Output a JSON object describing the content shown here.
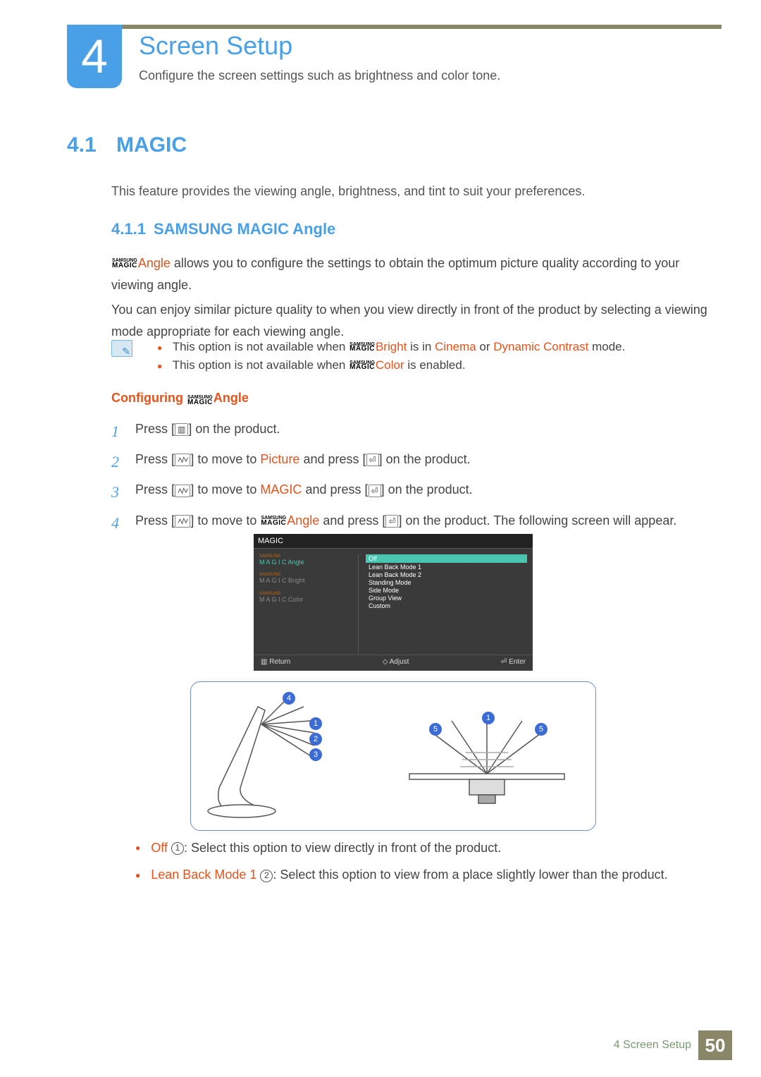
{
  "chapter": {
    "number": "4",
    "title": "Screen Setup",
    "desc": "Configure the screen settings such as brightness and color tone."
  },
  "section": {
    "number": "4.1",
    "title": "MAGIC",
    "intro": "This feature provides the viewing angle, brightness, and tint to suit your preferences."
  },
  "subsection": {
    "number": "4.1.1",
    "title": "SAMSUNG MAGIC Angle"
  },
  "para1_parts": {
    "angle": "Angle",
    "rest": " allows you to configure the settings to obtain the optimum picture quality according to your viewing angle."
  },
  "para2": "You can enjoy similar picture quality to when you view directly in front of the product by selecting a viewing mode appropriate for each viewing angle.",
  "notes": {
    "n1a": "This option is not available when ",
    "n1b": "Bright",
    "n1c": " is in ",
    "n1d": "Cinema",
    "n1e": " or ",
    "n1f": "Dynamic Contrast",
    "n1g": " mode.",
    "n2a": "This option is not available when ",
    "n2b": "Color",
    "n2c": " is enabled."
  },
  "config_heading": {
    "pre": "Configuring ",
    "post": "Angle"
  },
  "steps": {
    "s1": {
      "n": "1",
      "a": "Press [",
      "b": "] on the product."
    },
    "s2": {
      "n": "2",
      "a": "Press [",
      "b": "] to move to ",
      "c": "Picture",
      "d": " and press [",
      "e": "] on the product."
    },
    "s3": {
      "n": "3",
      "a": "Press [",
      "b": "] to move to ",
      "c": "MAGIC",
      "d": " and press [",
      "e": "] on the product."
    },
    "s4": {
      "n": "4",
      "a": "Press [",
      "b": "] to move to ",
      "c": "Angle",
      "d": " and press [",
      "e": "] on the product. The following screen will appear."
    }
  },
  "osd": {
    "title": "MAGIC",
    "left": {
      "angle": "Angle",
      "bright": "Bright",
      "color": "Color",
      "brand_top": "SAMSUNG",
      "brand_bot": "M A G I C"
    },
    "right": [
      "Off",
      "Lean Back Mode 1",
      "Lean Back Mode 2",
      "Standing Mode",
      "Side Mode",
      "Group View",
      "Custom"
    ],
    "foot": {
      "ret": "Return",
      "adj": "Adjust",
      "ent": "Enter"
    }
  },
  "diagram_labels": {
    "b4": "4",
    "b1": "1",
    "b2": "2",
    "b3": "3",
    "b5": "5"
  },
  "bottom": {
    "r1": {
      "a": "Off",
      "n": "1",
      "b": ": Select this option to view directly in front of the product."
    },
    "r2": {
      "a": "Lean Back Mode 1",
      "n": "2",
      "b": ": Select this option to view from a place slightly lower than the product."
    }
  },
  "footer": {
    "text": "4 Screen Setup",
    "page": "50"
  },
  "magic_logo": {
    "top": "SAMSUNG",
    "bot": "MAGIC"
  }
}
